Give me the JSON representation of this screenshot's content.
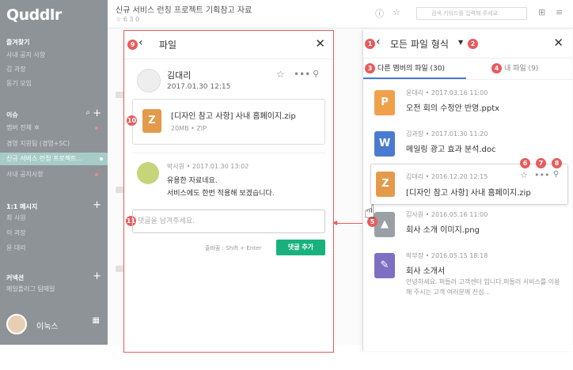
{
  "app": {
    "logo": "Quddlr"
  },
  "sidebar": {
    "sections": [
      {
        "title": "즐겨찾기",
        "items": [
          "사내 공지 사항",
          "김 과장",
          "동기 모임"
        ]
      },
      {
        "title": "이슈",
        "items": [
          "멤버 전체",
          "경영 지원팀 (경영+SC)",
          "신규 서비스 런칭 프로젝트...",
          "사내 공지사항"
        ]
      },
      {
        "title": "1:1 메시지",
        "items": [
          "최 사원",
          "이 과장",
          "윤 대리"
        ]
      },
      {
        "title": "커넥션",
        "items": [
          "메일플러그 팀메일"
        ]
      }
    ],
    "me": "이눅스"
  },
  "topbar": {
    "title": "신규 서비스 런칭 프로젝트 기획참고 자료",
    "meta": "6  3  0",
    "search_placeholder": "검색 키워드를 입력해 주세요"
  },
  "file_panel": {
    "badge": "9",
    "title": "파일",
    "uploader": {
      "name": "김대리",
      "time": "2017.01.30 12:15"
    },
    "attachment": {
      "badge": "10",
      "name": "[디자인 참고 사항] 사내 홈페이지.zip",
      "size": "20MB",
      "type": "ZIP"
    },
    "comment": {
      "author": "박사원",
      "time": "2017.01.30 13:02",
      "line1": "유용한 자료네요.",
      "line2": "서비스에도 한번 적용해 보겠습니다."
    },
    "input": {
      "badge": "11",
      "placeholder": "댓글을 남겨주세요."
    },
    "hint": "줄바꿈 : Shift + Enter",
    "submit": "댓글 추가"
  },
  "right_panel": {
    "back_badge": "1",
    "title": "모든 파일 형식",
    "dropdown_badge": "2",
    "tabs": [
      {
        "badge": "3",
        "label": "다른 멤버의 파일 (30)"
      },
      {
        "badge": "4",
        "label": "내 파일 (9)"
      }
    ],
    "files": [
      {
        "meta": "윤대리 • 2017.03.16 11:00",
        "name": "오전 회의 수정안 반영.pptx",
        "icon": "P",
        "color": "#f0a04b"
      },
      {
        "meta": "김과장 • 2017.01.30 11:20",
        "name": "메일링 광고 효과 분석.doc",
        "icon": "W",
        "color": "#4a7bd0"
      },
      {
        "meta": "김대리 • 2016.12.20 12:15",
        "name": "[디자인 참고 사항] 사내 홈페이지.zip",
        "icon": "Z",
        "color": "#e39a4a"
      },
      {
        "meta": "김사원 • 2016.05.16 11:00",
        "name": "회사 소개 이미지.png",
        "icon": "▲",
        "color": "#9aa0a6"
      },
      {
        "meta": "박부장 • 2016.05.15 18:18",
        "name": "회사 소개서",
        "icon": "✎",
        "color": "#7e6fc2",
        "desc": "안녕하세요. 퍼들러 고객센터 입니다.퍼들러 서비스를 이용해 주시는 고객 여러분께 진심..."
      }
    ],
    "hover_badges": {
      "star": "6",
      "more": "7",
      "pin": "8"
    },
    "link_badge": "5"
  }
}
